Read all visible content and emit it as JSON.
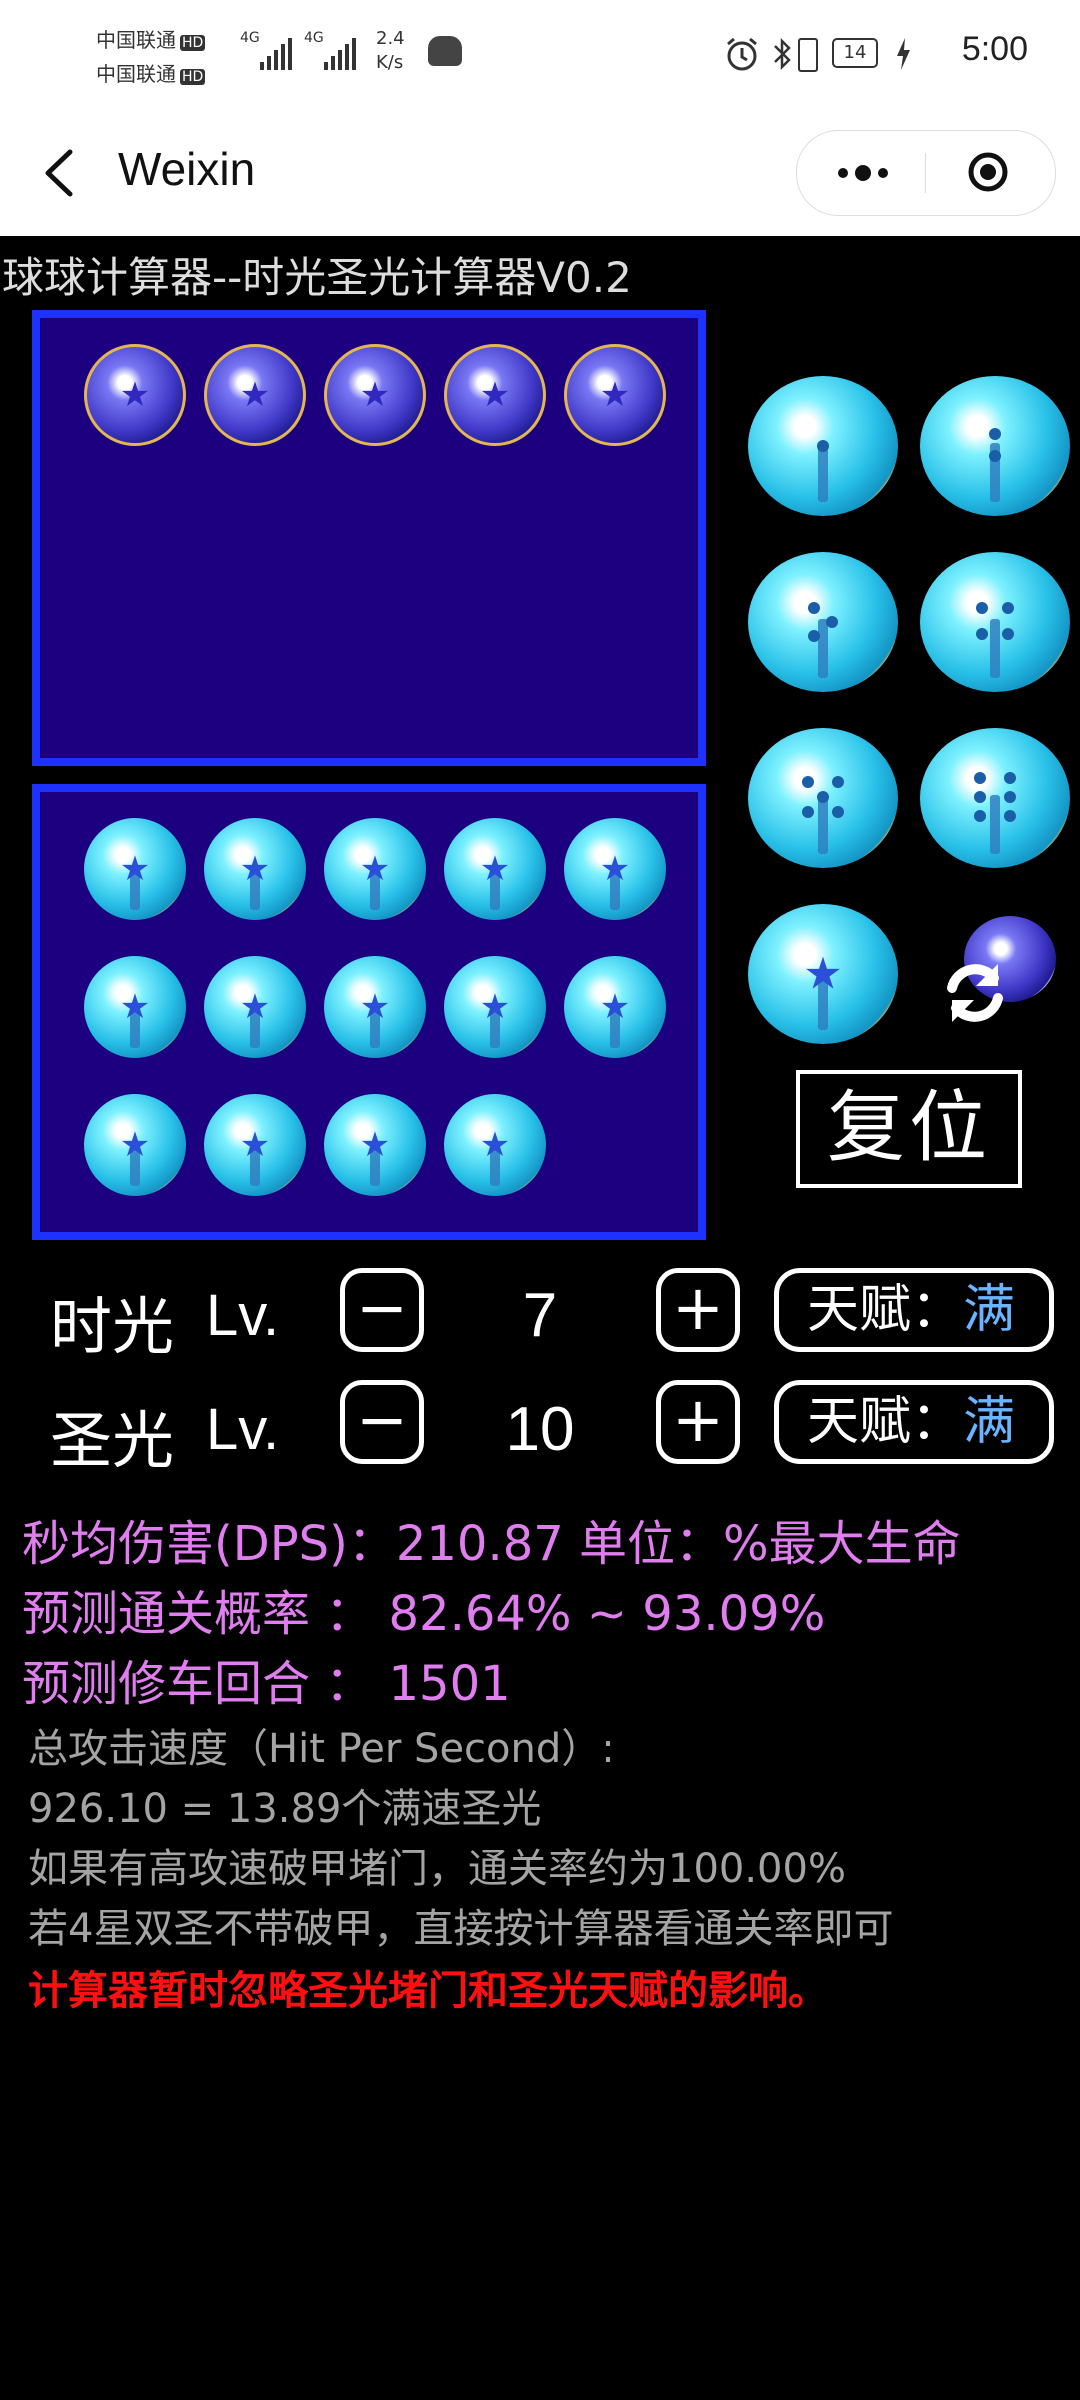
{
  "status_bar": {
    "carrier1": "中国联通",
    "carrier2": "中国联通",
    "hd_badge": "HD",
    "network1": "4G",
    "network2": "4G",
    "speed_value": "2.4",
    "speed_unit": "K/s",
    "battery": "14",
    "time": "5:00"
  },
  "nav": {
    "title": "Weixin"
  },
  "app": {
    "title": "球球计算器--时光圣光计算器V0.2"
  },
  "board": {
    "top_box_balls": [
      "purple-star",
      "purple-star",
      "purple-star",
      "purple-star",
      "purple-star"
    ],
    "bottom_box_balls": [
      "cyan-star",
      "cyan-star",
      "cyan-star",
      "cyan-star",
      "cyan-star",
      "cyan-star",
      "cyan-star",
      "cyan-star",
      "cyan-star",
      "cyan-star",
      "cyan-star",
      "cyan-star",
      "cyan-star",
      "cyan-star"
    ],
    "palette_balls": [
      "cyan-1-pip",
      "cyan-2-pip",
      "cyan-3-pip",
      "cyan-4-pip",
      "cyan-5-pip",
      "cyan-6-pip",
      "cyan-star"
    ],
    "reset_label": "复位"
  },
  "controls": {
    "row1": {
      "label": "时光",
      "lv_label": "Lv.",
      "minus": "−",
      "value": "7",
      "plus": "+",
      "talent_label": "天赋：",
      "talent_value": "满"
    },
    "row2": {
      "label": "圣光",
      "lv_label": "Lv.",
      "minus": "−",
      "value": "10",
      "plus": "+",
      "talent_label": "天赋：",
      "talent_value": "满"
    }
  },
  "results": {
    "dps": "秒均伤害(DPS)：210.87   单位：%最大生命",
    "clear_rate": "预测通关概率 ： 82.64% ~ 93.09%",
    "repair_round": "预测修车回合 ： 1501",
    "hps_title": "总攻击速度（Hit Per Second）:",
    "hps_value": "926.10 = 13.89个满速圣光",
    "note1": "如果有高攻速破甲堵门，通关率约为100.00%",
    "note2": "若4星双圣不带破甲，直接按计算器看通关率即可",
    "warning": "计算器暂时忽略圣光堵门和圣光天赋的影响。"
  },
  "colors": {
    "box_fill": "#1c0080",
    "box_border": "#1e32ff",
    "pink_text": "#e07ef0",
    "grey_text": "#a4a4a4",
    "warning_text": "#ff1010",
    "talent_value": "#6bb4ff"
  }
}
